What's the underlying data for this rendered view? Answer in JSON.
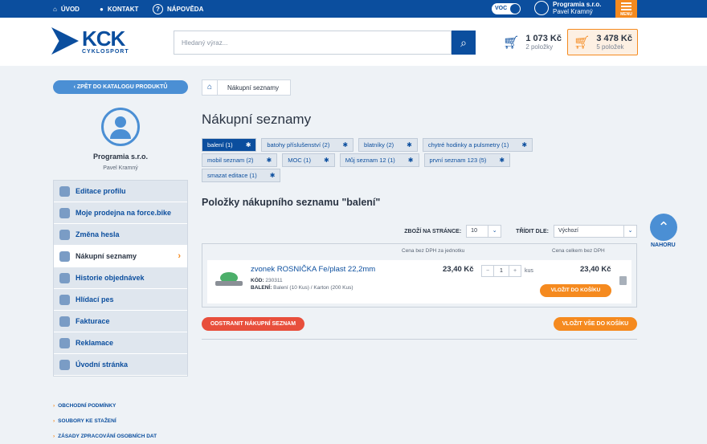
{
  "topbar": {
    "home": "ÚVOD",
    "contact": "KONTAKT",
    "help": "NÁPOVĚDA",
    "voc": "VOC",
    "company": "Programia s.r.o.",
    "user": "Pavel Kramný",
    "menu": "MENU"
  },
  "header": {
    "logo_main": "KCK",
    "logo_sub": "CYKLOSPORT",
    "search_placeholder": "Hledaný výraz...",
    "cart1_amount": "1 073 Kč",
    "cart1_count": "2 položky",
    "cart2_amount": "3 478 Kč",
    "cart2_count": "5 položek"
  },
  "sidebar": {
    "back": "ZPĚT DO KATALOGU PRODUKTŮ",
    "company": "Programia s.r.o.",
    "person": "Pavel Kramný",
    "items": [
      {
        "label": "Editace profilu",
        "icon": "user-icon"
      },
      {
        "label": "Moje prodejna na force.bike",
        "icon": "location-icon"
      },
      {
        "label": "Změna hesla",
        "icon": "lock-icon"
      },
      {
        "label": "Nákupní seznamy",
        "icon": "list-icon",
        "active": true
      },
      {
        "label": "Historie objednávek",
        "icon": "clipboard-icon"
      },
      {
        "label": "Hlídací pes",
        "icon": "eye-icon"
      },
      {
        "label": "Fakturace",
        "icon": "invoice-icon"
      },
      {
        "label": "Reklamace",
        "icon": "tools-icon"
      },
      {
        "label": "Úvodní stránka",
        "icon": "gear-icon"
      }
    ],
    "links": [
      "OBCHODNÍ PODMÍNKY",
      "SOUBORY KE STAŽENÍ",
      "ZÁSADY ZPRACOVÁNÍ OSOBNÍCH DAT"
    ]
  },
  "main": {
    "breadcrumb": "Nákupní seznamy",
    "title": "Nákupní seznamy",
    "chips": [
      "balení (1)",
      "batohy příslušenství (2)",
      "blatníky (2)",
      "chytré hodinky a pulsmetry (1)",
      "mobil seznam (2)",
      "MOC (1)",
      "Můj seznam 12 (1)",
      "první seznam 123 (5)",
      "smazat editace (1)"
    ],
    "subtitle": "Položky nákupního seznamu \"balení\"",
    "per_page_label": "ZBOŽÍ NA STRÁNCE:",
    "per_page_value": "10",
    "sort_label": "TŘÍDIT DLE:",
    "sort_value": "Výchozí",
    "col_unit": "Cena bez DPH za jednotku",
    "col_total": "Cena celkem bez DPH",
    "product": {
      "name": "zvonek ROSNIČKA Fe/plast 22,2mm",
      "code_label": "KÓD:",
      "code": "230311",
      "pack_label": "BALENÍ:",
      "pack": "Balení (10 Kus) / Karton (200 Kus)",
      "unit_price": "23,40 Kč",
      "qty": "1",
      "unit": "kus",
      "total": "23,40 Kč",
      "add": "VLOŽIT DO KOŠÍKU"
    },
    "remove_list": "ODSTRANIT NÁKUPNÍ SEZNAM",
    "add_all": "VLOŽIT VŠE DO KOŠÍKU"
  },
  "scroll_up": "NAHORU"
}
